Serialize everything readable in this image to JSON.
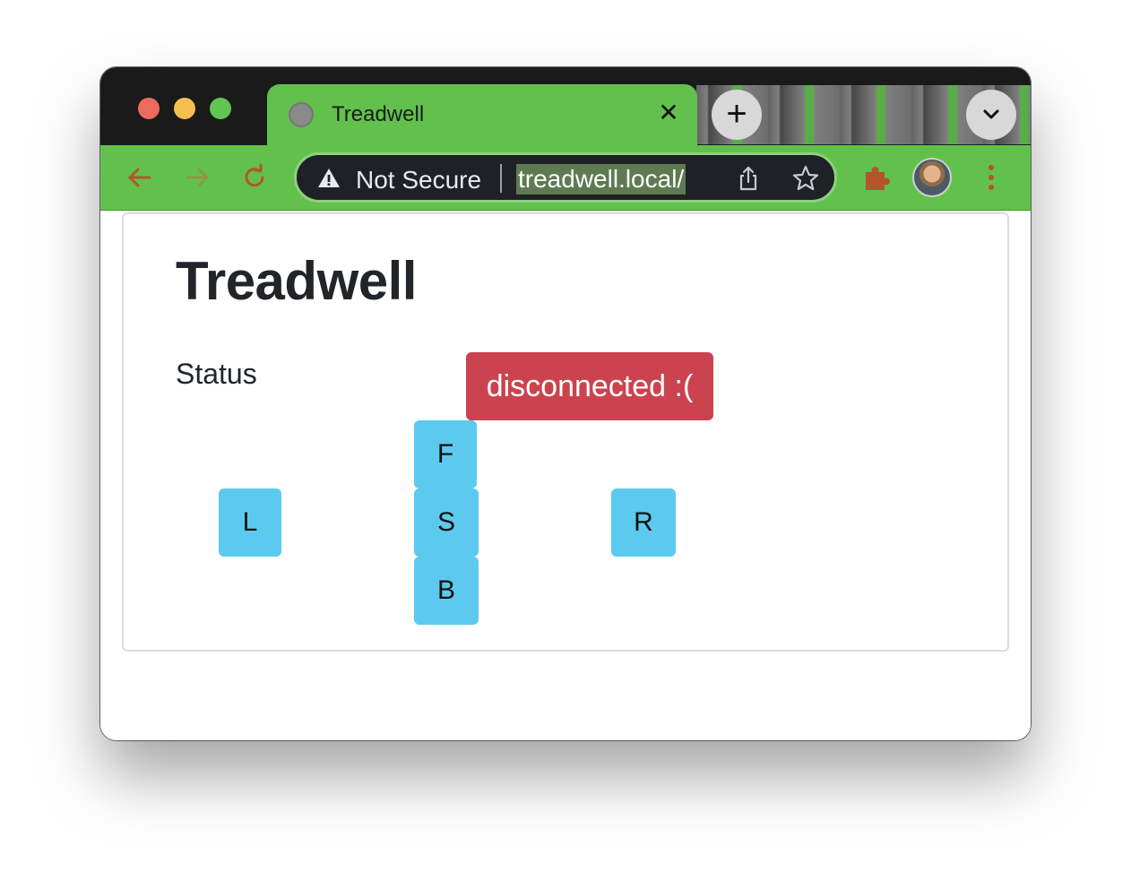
{
  "browser": {
    "tab": {
      "title": "Treadwell",
      "close_glyph": "✕"
    },
    "new_tab_glyph": "+",
    "omnibox": {
      "security_label": "Not Secure",
      "url": "treadwell.local/"
    },
    "icons": {
      "back": "arrow-left-icon",
      "forward": "arrow-right-icon",
      "reload": "reload-icon",
      "warning": "warning-triangle-icon",
      "share": "share-icon",
      "bookmark": "star-icon",
      "extensions": "puzzle-icon",
      "menu": "kebab-menu-icon",
      "tab_search": "chevron-down-icon"
    },
    "colors": {
      "theme_green": "#62c14c",
      "toolbar_icon": "#b5542c"
    }
  },
  "page": {
    "title": "Treadwell",
    "status_label": "Status",
    "status_value": "disconnected :(",
    "status_color": "#cb434e",
    "controls": {
      "forward": "F",
      "left": "L",
      "stop": "S",
      "right": "R",
      "back": "B"
    },
    "control_color": "#5ccaee"
  }
}
